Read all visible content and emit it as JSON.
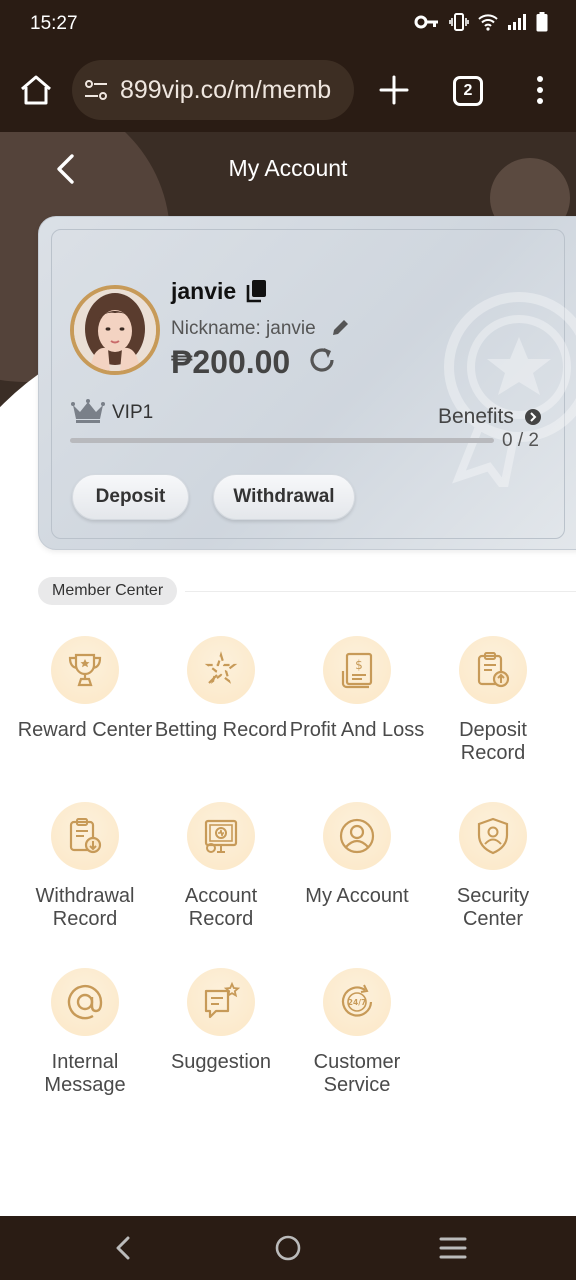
{
  "status_bar": {
    "time": "15:27",
    "icons": [
      "key-icon",
      "vibrate-icon",
      "wifi-icon",
      "signal-icon",
      "battery-icon"
    ]
  },
  "browser": {
    "url": "899vip.co/m/memb",
    "tab_count": "2",
    "icons": [
      "home-icon",
      "site-settings-icon",
      "plus-icon",
      "tabs-icon",
      "more-icon"
    ]
  },
  "header": {
    "title": "My Account",
    "back_icon": "chevron-left-icon"
  },
  "account_card": {
    "username": "janvie",
    "nickname": "Nickname: janvie",
    "balance": "₱200.00",
    "vip_level": "VIP1",
    "benefits_label": "Benefits",
    "progress_text": "0 / 2",
    "progress_fraction": 0,
    "deposit_label": "Deposit",
    "withdrawal_label": "Withdrawal"
  },
  "member_center": {
    "title": "Member Center",
    "items": [
      {
        "label": "Reward Center",
        "icon": "trophy-icon"
      },
      {
        "label": "Betting Record",
        "icon": "betting-icon"
      },
      {
        "label": "Profit And Loss",
        "icon": "profit-document-icon"
      },
      {
        "label": "Deposit Record",
        "icon": "deposit-record-icon"
      },
      {
        "label": "Withdrawal Record",
        "icon": "withdrawal-record-icon"
      },
      {
        "label": "Account Record",
        "icon": "account-record-icon"
      },
      {
        "label": "My Account",
        "icon": "user-icon"
      },
      {
        "label": "Security Center",
        "icon": "shield-user-icon"
      },
      {
        "label": "Internal Message",
        "icon": "at-icon"
      },
      {
        "label": "Suggestion",
        "icon": "suggestion-icon"
      },
      {
        "label": "Customer Service",
        "icon": "support-24-7-icon"
      }
    ]
  },
  "colors": {
    "system_bar": "#2a1c14",
    "accent_gold": "#c79a58",
    "icon_bg": "#fbe7c6"
  }
}
